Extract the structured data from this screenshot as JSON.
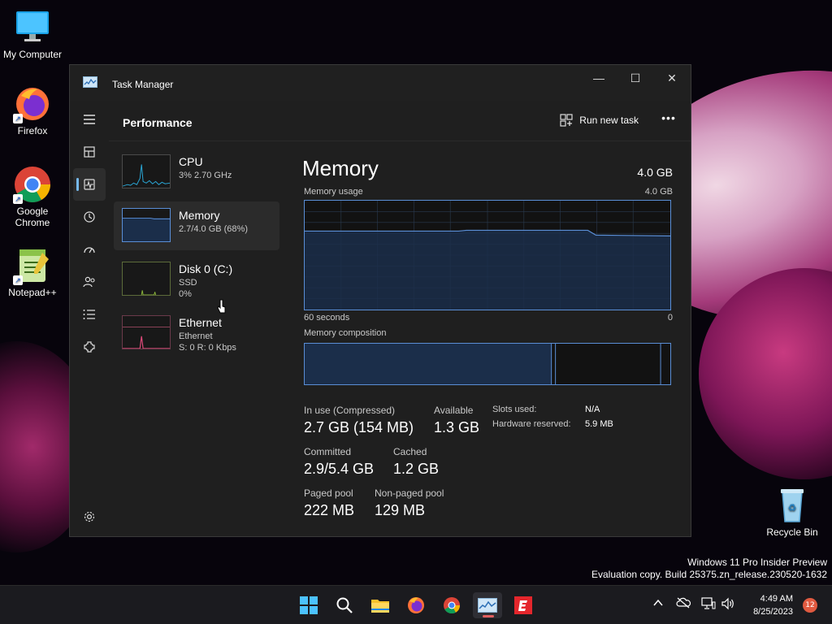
{
  "desktop": {
    "icons": [
      {
        "label": "My Computer"
      },
      {
        "label": "Firefox"
      },
      {
        "label": "Google Chrome"
      },
      {
        "label": "Notepad++"
      },
      {
        "label": "Recycle Bin"
      }
    ]
  },
  "window": {
    "title": "Task Manager",
    "controls": {
      "minimize": "—",
      "maximize": "☐",
      "close": "✕"
    }
  },
  "sidebar": {
    "items": [
      "hamburger-menu",
      "processes",
      "performance",
      "app-history",
      "startup-apps",
      "users",
      "details",
      "services",
      "settings"
    ],
    "active": "performance"
  },
  "header": {
    "page_title": "Performance",
    "run_new_task": "Run new task",
    "more": "•••"
  },
  "perf_list": [
    {
      "name": "CPU",
      "sub1": "3% 2.70 GHz",
      "sub2": ""
    },
    {
      "name": "Memory",
      "sub1": "2.7/4.0 GB (68%)",
      "sub2": ""
    },
    {
      "name": "Disk 0 (C:)",
      "sub1": "SSD",
      "sub2": "0%"
    },
    {
      "name": "Ethernet",
      "sub1": "Ethernet",
      "sub2": "S: 0 R: 0 Kbps"
    }
  ],
  "memory": {
    "title": "Memory",
    "total": "4.0 GB",
    "usage_label": "Memory usage",
    "usage_max": "4.0 GB",
    "axis_left": "60 seconds",
    "axis_right": "0",
    "composition_label": "Memory composition",
    "stats": {
      "in_use_label": "In use (Compressed)",
      "in_use_value": "2.7 GB (154 MB)",
      "available_label": "Available",
      "available_value": "1.3 GB",
      "committed_label": "Committed",
      "committed_value": "2.9/5.4 GB",
      "cached_label": "Cached",
      "cached_value": "1.2 GB",
      "paged_label": "Paged pool",
      "paged_value": "222 MB",
      "nonpaged_label": "Non-paged pool",
      "nonpaged_value": "129 MB",
      "slots_label": "Slots used:",
      "slots_value": "N/A",
      "hw_reserved_label": "Hardware reserved:",
      "hw_reserved_value": "5.9 MB"
    }
  },
  "taskbar": {
    "clock_time": "4:49 AM",
    "clock_date": "8/25/2023",
    "notification_count": "12"
  },
  "watermark": {
    "line1": "Windows 11 Pro Insider Preview",
    "line2": "Evaluation copy. Build 25375.zn_release.230520-1632"
  },
  "colors": {
    "accent": "#76b9ed",
    "graph_border": "#5a8ed6",
    "graph_fill": "#1b2e4a"
  }
}
